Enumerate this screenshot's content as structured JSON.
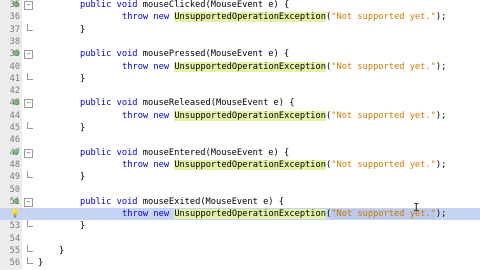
{
  "editor": {
    "lines": [
      {
        "num": "35",
        "marker": "override",
        "fold": "minus",
        "indent": 1,
        "parts": [
          {
            "t": "public void ",
            "c": "kw"
          },
          {
            "t": "mouseClicked",
            "c": "typ"
          },
          {
            "t": "(MouseEvent e) {",
            "c": "typ"
          }
        ]
      },
      {
        "num": "36",
        "marker": "",
        "fold": "",
        "indent": 2,
        "parts": [
          {
            "t": "throw new ",
            "c": "kw"
          },
          {
            "t": "UnsupportedOperationException",
            "c": "hl"
          },
          {
            "t": "(",
            "c": "typ"
          },
          {
            "t": "\"Not supported yet.\"",
            "c": "str"
          },
          {
            "t": ");",
            "c": "typ"
          }
        ]
      },
      {
        "num": "37",
        "marker": "",
        "fold": "end",
        "indent": 1,
        "parts": [
          {
            "t": "}",
            "c": "typ"
          }
        ]
      },
      {
        "num": "38",
        "marker": "",
        "fold": "",
        "indent": 0,
        "parts": []
      },
      {
        "num": "39",
        "marker": "override",
        "fold": "minus",
        "indent": 1,
        "parts": [
          {
            "t": "public void ",
            "c": "kw"
          },
          {
            "t": "mousePressed",
            "c": "typ"
          },
          {
            "t": "(MouseEvent e) {",
            "c": "typ"
          }
        ]
      },
      {
        "num": "40",
        "marker": "",
        "fold": "",
        "indent": 2,
        "parts": [
          {
            "t": "throw new ",
            "c": "kw"
          },
          {
            "t": "UnsupportedOperationException",
            "c": "hl"
          },
          {
            "t": "(",
            "c": "typ"
          },
          {
            "t": "\"Not supported yet.\"",
            "c": "str"
          },
          {
            "t": ");",
            "c": "typ"
          }
        ]
      },
      {
        "num": "41",
        "marker": "",
        "fold": "end",
        "indent": 1,
        "parts": [
          {
            "t": "}",
            "c": "typ"
          }
        ]
      },
      {
        "num": "42",
        "marker": "",
        "fold": "",
        "indent": 0,
        "parts": []
      },
      {
        "num": "43",
        "marker": "override",
        "fold": "minus",
        "indent": 1,
        "parts": [
          {
            "t": "public void ",
            "c": "kw"
          },
          {
            "t": "mouseReleased",
            "c": "typ"
          },
          {
            "t": "(MouseEvent e) {",
            "c": "typ"
          }
        ]
      },
      {
        "num": "44",
        "marker": "",
        "fold": "",
        "indent": 2,
        "parts": [
          {
            "t": "throw new ",
            "c": "kw"
          },
          {
            "t": "UnsupportedOperationException",
            "c": "hl"
          },
          {
            "t": "(",
            "c": "typ"
          },
          {
            "t": "\"Not supported yet.\"",
            "c": "str"
          },
          {
            "t": ");",
            "c": "typ"
          }
        ]
      },
      {
        "num": "45",
        "marker": "",
        "fold": "end",
        "indent": 1,
        "parts": [
          {
            "t": "}",
            "c": "typ"
          }
        ]
      },
      {
        "num": "46",
        "marker": "",
        "fold": "",
        "indent": 0,
        "parts": []
      },
      {
        "num": "47",
        "marker": "override",
        "fold": "minus",
        "indent": 1,
        "parts": [
          {
            "t": "public void ",
            "c": "kw"
          },
          {
            "t": "mouseEntered",
            "c": "typ"
          },
          {
            "t": "(MouseEvent e) {",
            "c": "typ"
          }
        ]
      },
      {
        "num": "48",
        "marker": "",
        "fold": "",
        "indent": 2,
        "parts": [
          {
            "t": "throw new ",
            "c": "kw"
          },
          {
            "t": "UnsupportedOperationException",
            "c": "hl"
          },
          {
            "t": "(",
            "c": "typ"
          },
          {
            "t": "\"Not supported yet.\"",
            "c": "str"
          },
          {
            "t": ");",
            "c": "typ"
          }
        ]
      },
      {
        "num": "49",
        "marker": "",
        "fold": "end",
        "indent": 1,
        "parts": [
          {
            "t": "}",
            "c": "typ"
          }
        ]
      },
      {
        "num": "50",
        "marker": "",
        "fold": "",
        "indent": 0,
        "parts": []
      },
      {
        "num": "51",
        "marker": "override",
        "fold": "minus",
        "indent": 1,
        "parts": [
          {
            "t": "public void ",
            "c": "kw"
          },
          {
            "t": "mouseExited",
            "c": "typ"
          },
          {
            "t": "(MouseEvent e) {",
            "c": "typ"
          }
        ]
      },
      {
        "num": "",
        "marker": "bulb",
        "fold": "",
        "indent": 2,
        "current": true,
        "parts": [
          {
            "t": "throw new ",
            "c": "kw"
          },
          {
            "t": "UnsupportedOperationException",
            "c": "hl"
          },
          {
            "t": "(",
            "c": "typ"
          },
          {
            "t": "\"Not supported yet.\"",
            "c": "strsel"
          },
          {
            "t": ");",
            "c": "typ"
          }
        ]
      },
      {
        "num": "53",
        "marker": "",
        "fold": "end",
        "indent": 1,
        "parts": [
          {
            "t": "}",
            "c": "typ"
          }
        ]
      },
      {
        "num": "54",
        "marker": "",
        "fold": "",
        "indent": 0,
        "parts": []
      },
      {
        "num": "55",
        "marker": "",
        "fold": "end",
        "indent": 0.5,
        "parts": [
          {
            "t": "}",
            "c": "typ"
          }
        ]
      },
      {
        "num": "56",
        "marker": "",
        "fold": "end",
        "indent": 0,
        "parts": [
          {
            "t": "}",
            "c": "typ"
          }
        ]
      }
    ],
    "markers": {
      "override": "⊕",
      "bulb": "💡"
    },
    "fold_symbols": {
      "minus": "−"
    },
    "colors": {
      "keyword": "#0000e6",
      "string": "#ce7b00",
      "highlight": "#e4f2a8",
      "current_line": "#c6d3f3"
    }
  }
}
